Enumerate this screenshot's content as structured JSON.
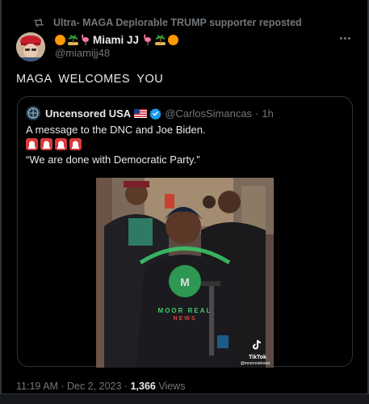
{
  "repost": {
    "icon": "repost-icon",
    "text": "Ultra- MAGA Deplorable TRUMP supporter reposted"
  },
  "author": {
    "display_name": "Miami JJ",
    "handle": "@miamijj48",
    "avatar": "avatar-red-cap"
  },
  "tweet": {
    "text": "MAGA WELCOMES YOU"
  },
  "quote": {
    "name": "Uncensored USA",
    "handle": "@CarlosSimancas",
    "time": "1h",
    "line1": "A message to the DNC and Joe Biden.",
    "line3": "“We are done with Democratic Party.”",
    "video_labels": {
      "watermark_line1": "MOOR REAL",
      "watermark_line2": "NEWS",
      "tiktok_brand": "TikTok",
      "tiktok_handle": "@moorrealnews"
    }
  },
  "meta": {
    "time": "11:19 AM",
    "date": "Dec 2, 2023",
    "views_count": "1,366",
    "views_label": "Views"
  },
  "colors": {
    "background": "#000000",
    "text": "#e7e9ea",
    "muted": "#71767b",
    "border": "#2f3336",
    "verified": "#1d9bf0"
  }
}
